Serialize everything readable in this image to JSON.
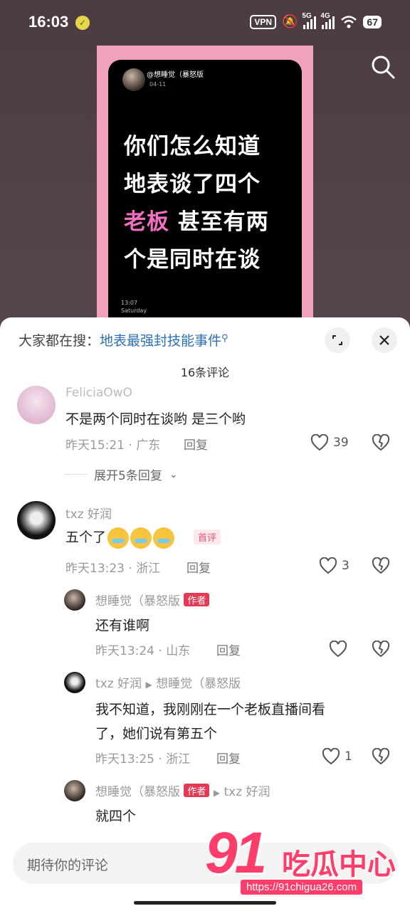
{
  "status_bar": {
    "time": "16:03",
    "vpn": "VPN",
    "net1": "5G",
    "net2": "4G",
    "battery": "67"
  },
  "post_image": {
    "user": "@想睡觉（暴怒版",
    "date": "04-11",
    "line1": "你们怎么知道",
    "line2": "地表谈了四个",
    "line3_highlight": "老板",
    "line3_rest": "甚至有两",
    "line4": "个是同时在谈",
    "footer_time": "13:07",
    "footer_day": "Saturday",
    "highlight_color": "#f06fc0"
  },
  "trending": {
    "prefix": "大家都在搜：",
    "query": "地表最强封技能事件"
  },
  "comments_count": "16条评论",
  "comments": [
    {
      "name": "FeliciaOwO",
      "text": "不是两个同时在谈哟 是三个哟",
      "meta": "昨天15:21 · 广东",
      "reply": "回复",
      "likes": "39"
    },
    {
      "expand_label": "展开5条回复"
    },
    {
      "name": "txz 好润",
      "text": "五个了",
      "badge": "首评",
      "meta": "昨天13:23 · 浙江",
      "reply": "回复",
      "likes": "3"
    }
  ],
  "replies": [
    {
      "name": "想睡觉（暴怒版",
      "tag": "作者",
      "text": "还有谁啊",
      "meta": "昨天13:24 · 山东",
      "reply": "回复"
    },
    {
      "name": "txz 好润",
      "to": "想睡觉（暴怒版",
      "text1": "我不知道，我刚刚在一个老板直播间看",
      "text2": "了，她们说有第五个",
      "meta": "昨天13:25 · 浙江",
      "reply": "回复",
      "likes": "1"
    },
    {
      "name": "想睡觉（暴怒版",
      "tag": "作者",
      "to": "txz 好润",
      "text": "就四个"
    }
  ],
  "input_placeholder": "期待你的评论",
  "watermark": {
    "number": "91",
    "brand": "吃瓜中心",
    "url": "https://91chigua26.com"
  }
}
